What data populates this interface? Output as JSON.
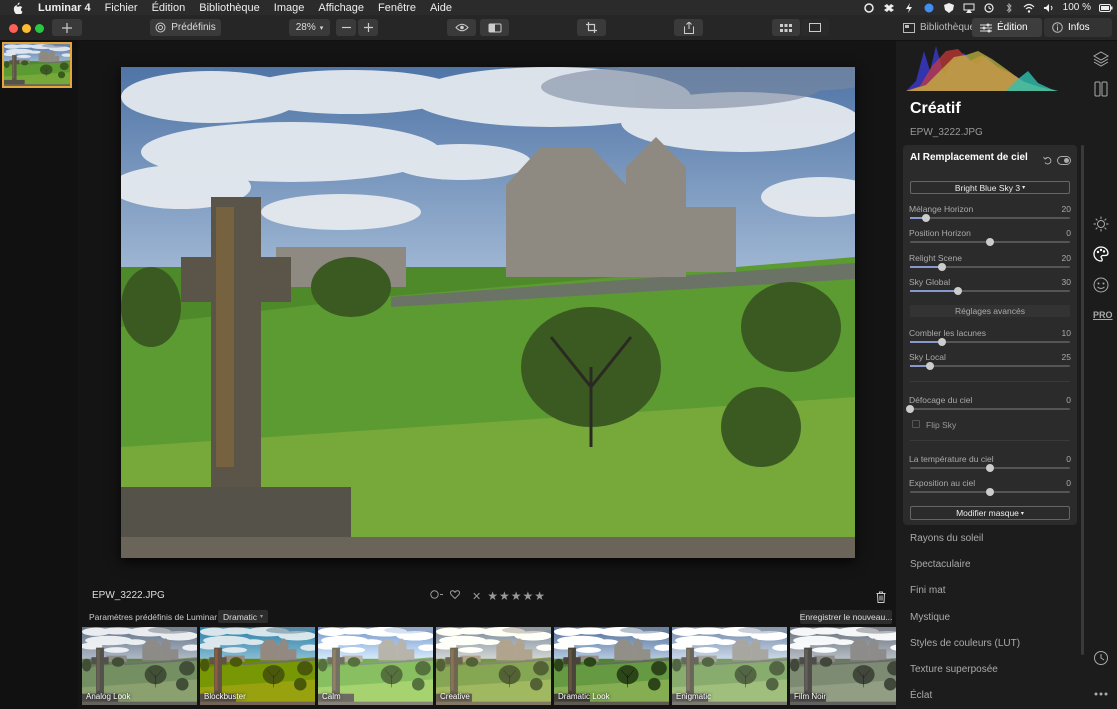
{
  "menubar": {
    "app": "Luminar 4",
    "items": [
      "Fichier",
      "Édition",
      "Bibliothèque",
      "Image",
      "Affichage",
      "Fenêtre",
      "Aide"
    ],
    "battery": "100 %"
  },
  "toolbar": {
    "presets_label": "Prédéfinis",
    "zoom": "28%",
    "tabs": {
      "library": "Bibliothèque",
      "edit": "Édition",
      "info": "Infos"
    }
  },
  "photo": {
    "filename": "EPW_3222.JPG",
    "rating_stars": 0
  },
  "presets": {
    "label": "Paramètres prédéfinis de Luminar :",
    "selected": "Dramatic",
    "save_button": "Enregistrer le nouveau...",
    "items": [
      "Analog Look",
      "Blockbuster",
      "Calm",
      "Creative",
      "Dramatic Look",
      "Enigmatic",
      "Film Noir"
    ]
  },
  "panel": {
    "title": "Créatif",
    "filename": "EPW_3222.JPG",
    "tool": {
      "title": "AI Remplacement de ciel",
      "sky_select": "Bright Blue Sky 3",
      "sliders": [
        {
          "label": "Mélange Horizon",
          "value": "20",
          "level": 0.1
        },
        {
          "label": "Position Horizon",
          "value": "0",
          "level": 0.5
        },
        {
          "label": "Relight Scene",
          "value": "20",
          "level": 0.2
        },
        {
          "label": "Sky Global",
          "value": "30",
          "level": 0.3
        }
      ],
      "advanced_label": "Réglages avancés",
      "advanced_sliders": [
        {
          "label": "Combler les lacunes",
          "value": "10",
          "level": 0.2
        },
        {
          "label": "Sky Local",
          "value": "25",
          "level": 0.125
        }
      ],
      "defocus": {
        "label": "Défocage du ciel",
        "value": "0",
        "level": 0.0
      },
      "flip_sky": {
        "label": "Flip Sky",
        "checked": false
      },
      "temperature": {
        "label": "La température du ciel",
        "value": "0",
        "level": 0.5
      },
      "exposure": {
        "label": "Exposition au ciel",
        "value": "0",
        "level": 0.5
      },
      "mask_button": "Modifier masque"
    },
    "sections": [
      "Rayons du soleil",
      "Spectaculaire",
      "Fini mat",
      "Mystique",
      "Styles de couleurs (LUT)",
      "Texture superposée",
      "Éclat"
    ]
  },
  "side_icons": [
    "layers-icon",
    "canvas-icon",
    "sun-icon",
    "palette-icon",
    "smiley-icon",
    "pro-icon",
    "history-icon",
    "more-icon"
  ],
  "side_text": {
    "pro": "PRO"
  },
  "colors": {
    "accent_orange": "#e3a63a",
    "slider_fill": "#8899cc"
  }
}
